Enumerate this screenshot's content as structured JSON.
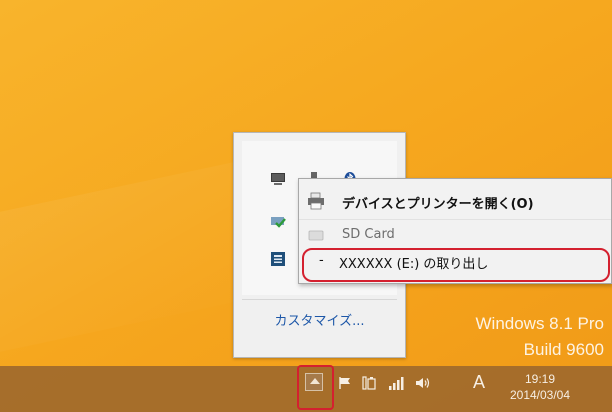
{
  "desktop": {
    "watermark_line1": "Windows 8.1 Pro",
    "watermark_line2": "Build 9600"
  },
  "tray_panel": {
    "customize_label": "カスタマイズ...",
    "icons": [
      "monitor-icon",
      "usb-device-icon",
      "bluetooth-icon",
      "security-check-icon",
      "app-icon"
    ]
  },
  "context_menu": {
    "open_devices_label": "デバイスとプリンターを開く(O)",
    "device_header": "SD Card",
    "eject_dash": "-",
    "eject_label": "XXXXXX (E:) の取り出し"
  },
  "taskbar": {
    "ime_label": "A",
    "time": "19:19",
    "date": "2014/03/04",
    "icons": [
      "show-hidden-icons-button",
      "flag-icon",
      "power-icon",
      "network-icon",
      "volume-icon"
    ]
  },
  "colors": {
    "desktop": "#f5a623",
    "taskbar": "#9d682c",
    "highlight": "#d4202f",
    "link": "#1d57a8"
  }
}
